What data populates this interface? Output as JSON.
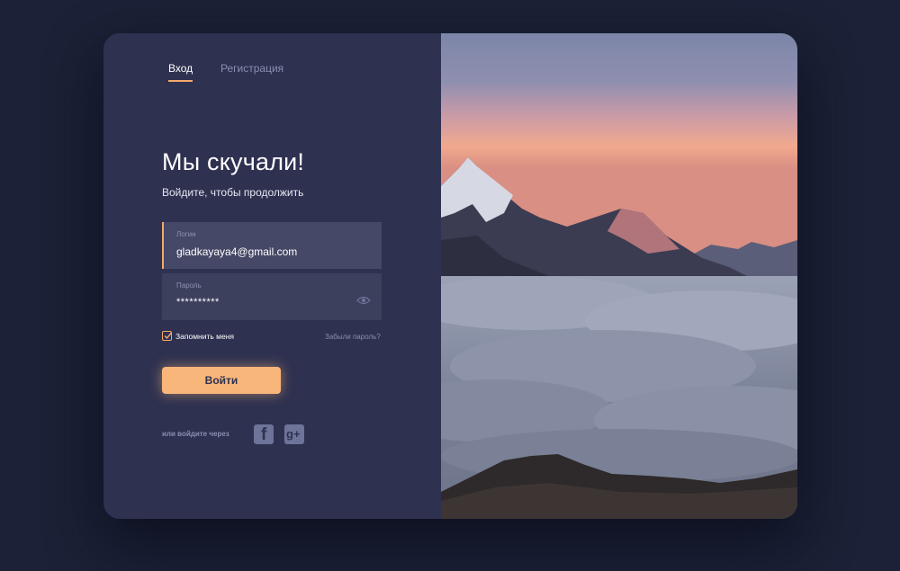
{
  "tabs": {
    "login": "Вход",
    "register": "Регистрация"
  },
  "heading": {
    "title": "Мы скучали!",
    "subtitle": "Войдите, чтобы продолжить"
  },
  "login_field": {
    "label": "Логин",
    "value": "gladkayaya4@gmail.com"
  },
  "password_field": {
    "label": "Пароль",
    "value": "**********"
  },
  "remember": {
    "label": "Запомнить меня",
    "checked": true
  },
  "forgot_link": "Забыли пароль?",
  "submit_button": "Войти",
  "social": {
    "label": "или войдите через",
    "providers": [
      "facebook-icon",
      "google-plus-icon"
    ]
  },
  "colors": {
    "accent": "#f9b67a",
    "panel": "#2e3150",
    "background": "#1b2136"
  }
}
